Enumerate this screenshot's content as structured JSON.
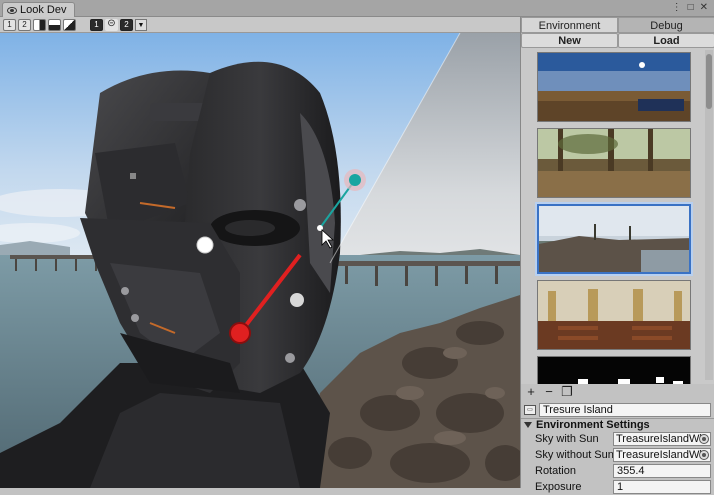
{
  "window": {
    "tab_title": "Look Dev",
    "menu_glyph": "⋮",
    "maximize_glyph": "□",
    "close_glyph": "✕"
  },
  "toolbar": {
    "view1_label": "1",
    "view2_label": "2",
    "link_glyph": "⊝",
    "cam1_label": "1",
    "cam2_label": "2",
    "dropdown_glyph": "▼"
  },
  "panel": {
    "tabs": [
      {
        "label": "Environment",
        "active": true
      },
      {
        "label": "Debug",
        "active": false
      }
    ],
    "new_label": "New",
    "load_label": "Load",
    "add_glyph": "+",
    "remove_glyph": "−",
    "duplicate_glyph": "❐",
    "environment_name": "Tresure Island",
    "settings": {
      "title": "Environment Settings",
      "rows": [
        {
          "label": "Sky with Sun",
          "value": "TreasureIslandWh"
        },
        {
          "label": "Sky without Sun",
          "value": "TreasureIslandWh"
        },
        {
          "label": "Rotation",
          "value": "355.4"
        },
        {
          "label": "Exposure",
          "value": "1"
        }
      ]
    }
  },
  "environments": [
    {
      "name": "desert-night",
      "selected": false
    },
    {
      "name": "forest",
      "selected": false
    },
    {
      "name": "treasure-island",
      "selected": true
    },
    {
      "name": "church-interior",
      "selected": false
    },
    {
      "name": "studio-dark",
      "selected": false
    }
  ],
  "colors": {
    "accent": "#3a72c4",
    "sun_handle": "#e02020",
    "light_handle": "#1aa5a0"
  }
}
